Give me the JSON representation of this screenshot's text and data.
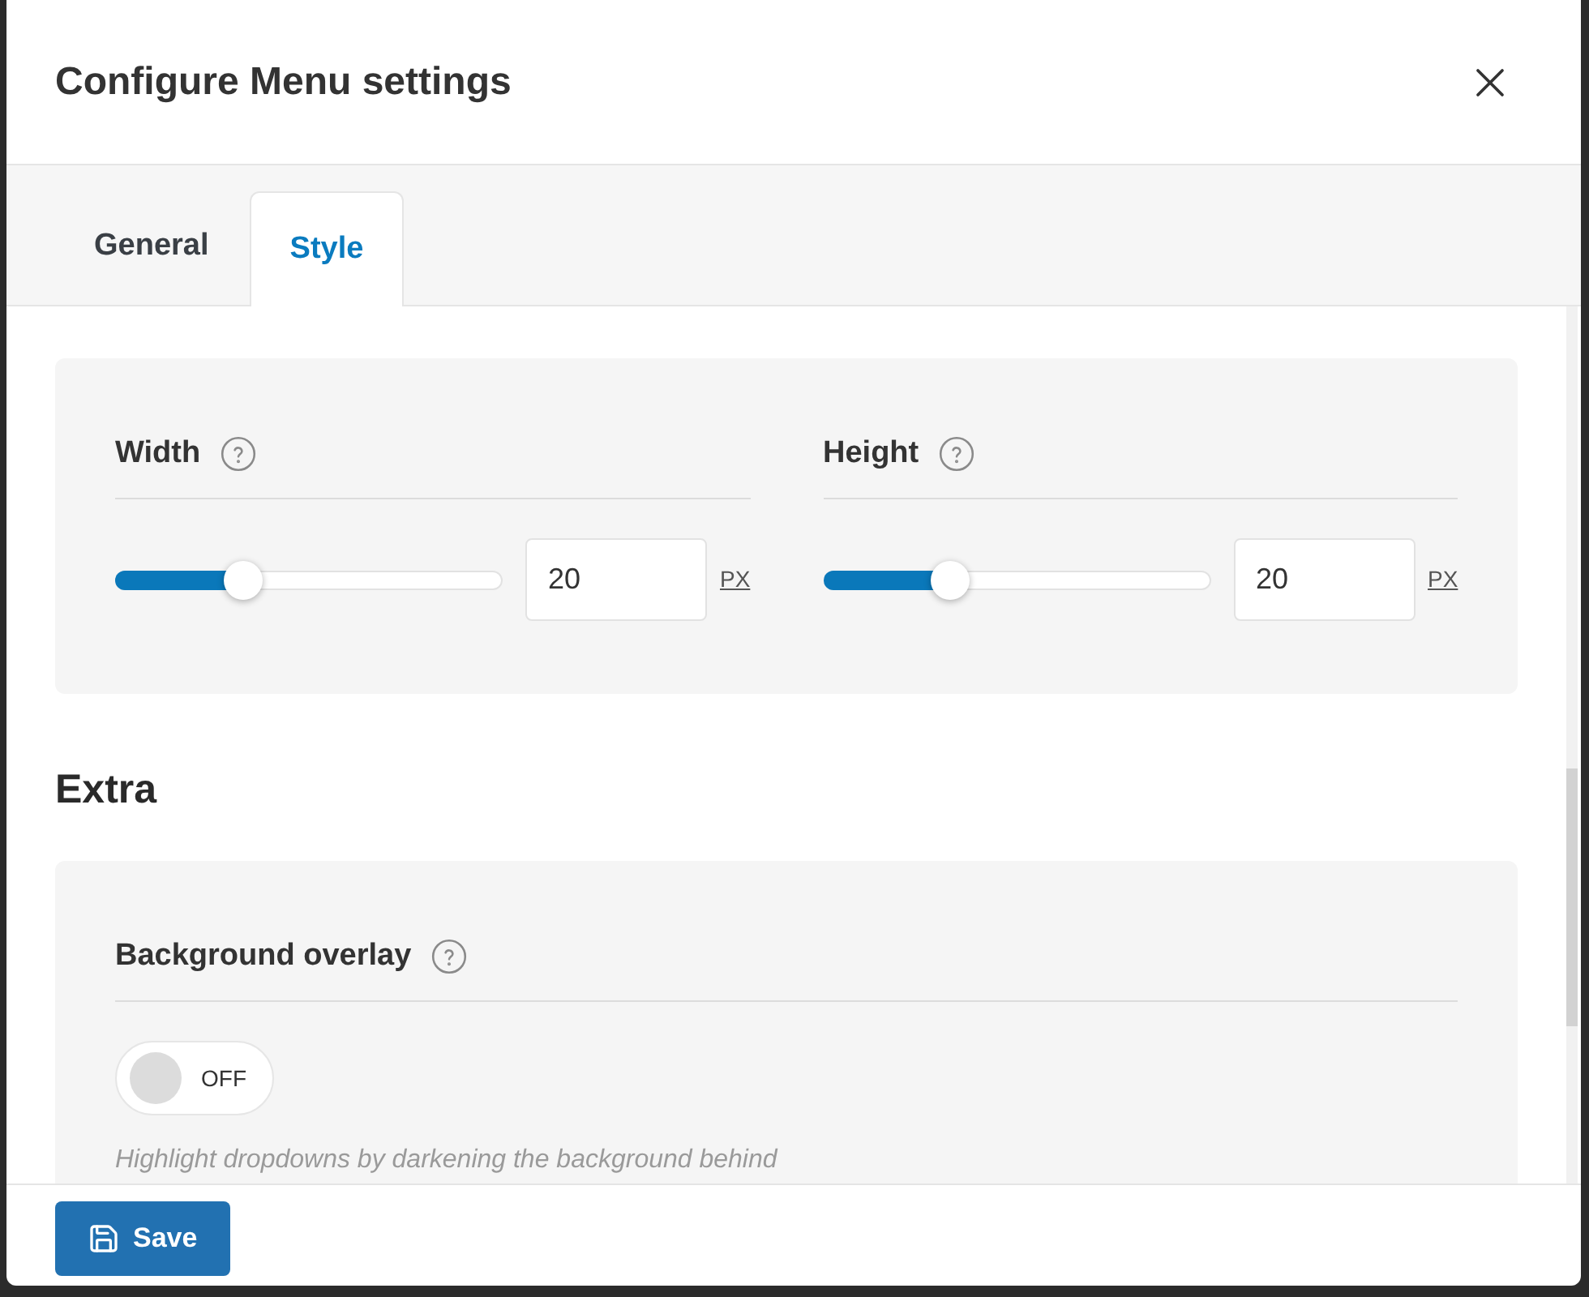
{
  "dialog": {
    "title": "Configure Menu settings"
  },
  "tabs": [
    {
      "label": "General",
      "selected": false
    },
    {
      "label": "Style",
      "selected": true
    }
  ],
  "size_settings": [
    {
      "label": "Width",
      "level": 0.33,
      "value": "20",
      "unit": "PX"
    },
    {
      "label": "Height",
      "level": 0.33,
      "value": "20",
      "unit": "PX"
    }
  ],
  "extra": {
    "heading": "Extra",
    "settings": [
      {
        "kind": "toggle",
        "label": "Background overlay",
        "on": false,
        "state_label": "OFF",
        "description": "Highlight dropdowns by darkening the background behind"
      }
    ]
  },
  "footer": {
    "save_button": "Save"
  }
}
